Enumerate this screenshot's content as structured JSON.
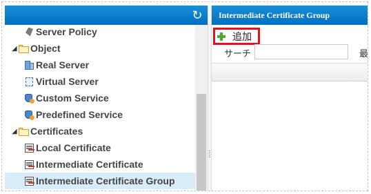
{
  "tree": {
    "items": [
      {
        "label": "Server Policy",
        "icon": "policy-icon",
        "level": 2
      },
      {
        "label": "Object",
        "icon": "folder-icon",
        "level": 1,
        "expanded": true
      },
      {
        "label": "Real Server",
        "icon": "server-icon",
        "level": 2
      },
      {
        "label": "Virtual Server",
        "icon": "virtual-server-icon",
        "level": 2
      },
      {
        "label": "Custom Service",
        "icon": "service-icon",
        "level": 2
      },
      {
        "label": "Predefined Service",
        "icon": "service-icon",
        "level": 2
      },
      {
        "label": "Certificates",
        "icon": "folder-icon",
        "level": 1,
        "expanded": true
      },
      {
        "label": "Local Certificate",
        "icon": "certificate-icon",
        "level": 2
      },
      {
        "label": "Intermediate Certificate",
        "icon": "certificate-icon",
        "level": 2
      },
      {
        "label": "Intermediate Certificate Group",
        "icon": "certificate-icon",
        "level": 2,
        "selected": true
      }
    ]
  },
  "right": {
    "title": "Intermediate Certificate Group",
    "add_label": "追加",
    "search_label": "サーチ",
    "search_value": "",
    "search_extra": "最"
  },
  "colors": {
    "header_blue": "#0070c0",
    "highlight_red": "#e0141e",
    "selected_row": "#d9ecfa",
    "add_green": "#4aaa2e"
  }
}
